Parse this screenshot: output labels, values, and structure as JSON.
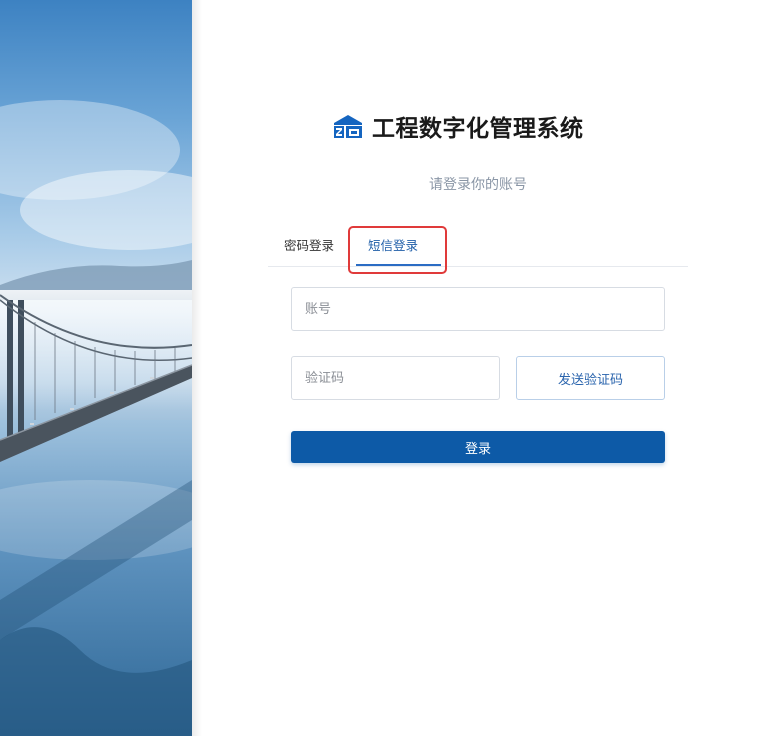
{
  "brand": {
    "title": "工程数字化管理系统",
    "logo_icon": "building-logo-icon",
    "logo_color": "#1565c0"
  },
  "subtitle": "请登录你的账号",
  "tabs": [
    {
      "label": "密码登录",
      "active": false
    },
    {
      "label": "短信登录",
      "active": true
    }
  ],
  "form": {
    "account_placeholder": "账号",
    "code_placeholder": "验证码",
    "send_code_label": "发送验证码",
    "login_label": "登录"
  },
  "colors": {
    "primary": "#0d5aa7",
    "active_tab": "#1f5ea8",
    "highlight": "#e03a3a"
  },
  "background": {
    "image": "golden-gate-bridge-in-fog"
  }
}
